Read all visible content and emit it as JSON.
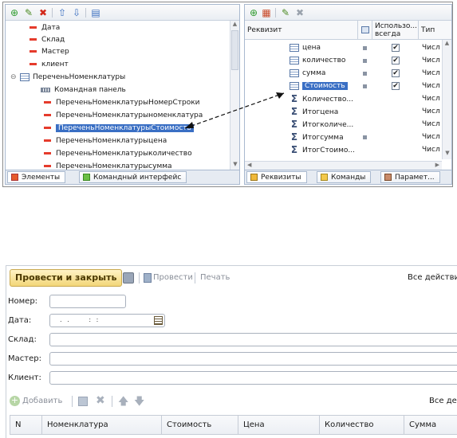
{
  "top_window": {
    "left_panel": {
      "tree": [
        {
          "text": "Дата"
        },
        {
          "text": "Склад"
        },
        {
          "text": "Мастер"
        },
        {
          "text": "клиент"
        },
        {
          "text": "ПереченьНоменклатуры"
        },
        {
          "text": "Командная панель"
        },
        {
          "text": "ПереченьНоменклатурыНомерСтроки"
        },
        {
          "text": "ПереченьНоменклатурыноменклатура"
        },
        {
          "text": "ПереченьНоменклатурыСтоимость"
        },
        {
          "text": "ПереченьНоменклатурыцена"
        },
        {
          "text": "ПереченьНоменклатурыколичество"
        },
        {
          "text": "ПереченьНоменклатурысумма"
        }
      ],
      "tabs": [
        "Элементы",
        "Командный интерфейс"
      ]
    },
    "right_panel": {
      "headers": {
        "rekvizit": "Реквизит",
        "always_1": "Использо...",
        "always_2": "всегда",
        "type": "Тип"
      },
      "rows": [
        {
          "name": "цена",
          "type": "Числ"
        },
        {
          "name": "количество",
          "type": "Числ"
        },
        {
          "name": "сумма",
          "type": "Числ"
        },
        {
          "name": "Стоимость",
          "type": "Числ"
        },
        {
          "name": "Количество...",
          "type": "Числ"
        },
        {
          "name": "Итогцена",
          "type": "Числ"
        },
        {
          "name": "Итогколиче...",
          "type": "Числ"
        },
        {
          "name": "Итогсумма",
          "type": "Числ"
        },
        {
          "name": "ИтогСтоимо...",
          "type": "Числ"
        }
      ],
      "tabs": [
        "Реквизиты",
        "Команды",
        "Парамет..."
      ]
    }
  },
  "form": {
    "toolbar": {
      "post_close": "Провести и закрыть",
      "post": "Провести",
      "print": "Печать",
      "all_actions": "Все действи"
    },
    "fields": {
      "number_label": "Номер:",
      "date_label": "Дата:",
      "date_mask": ". .     : :",
      "warehouse_label": "Склад:",
      "master_label": "Мастер:",
      "client_label": "Клиент:"
    },
    "table_toolbar": {
      "add": "Добавить",
      "all_actions": "Все де"
    },
    "table_headers": [
      "N",
      "Номенклатура",
      "Стоимость",
      "Цена",
      "Количество",
      "Сумма"
    ]
  },
  "colors": {
    "accent": "#3a6fc4",
    "marker": "#e53b2c",
    "button": "#f2d678"
  }
}
